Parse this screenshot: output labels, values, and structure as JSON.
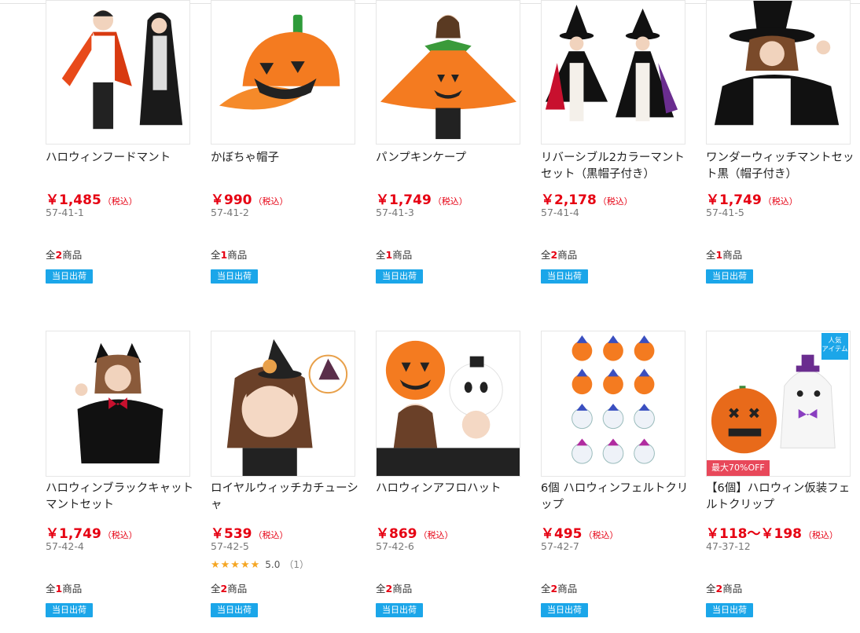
{
  "tax_label": "（税込）",
  "shipping_badge": "当日出荷",
  "count_prefix": "全",
  "count_suffix": "商品",
  "products": [
    {
      "name": "ハロウィンフードマント",
      "price": "￥1,485",
      "code": "57-41-1",
      "count": "2"
    },
    {
      "name": "かぼちゃ帽子",
      "price": "￥990",
      "code": "57-41-2",
      "count": "1"
    },
    {
      "name": "パンプキンケープ",
      "price": "￥1,749",
      "code": "57-41-3",
      "count": "1"
    },
    {
      "name": "リバーシブル2カラーマントセット（黒帽子付き）",
      "price": "￥2,178",
      "code": "57-41-4",
      "count": "2"
    },
    {
      "name": "ワンダーウィッチマントセット黒（帽子付き）",
      "price": "￥1,749",
      "code": "57-41-5",
      "count": "1"
    },
    {
      "name": "ハロウィンブラックキャットマントセット",
      "price": "￥1,749",
      "code": "57-42-4",
      "count": "1"
    },
    {
      "name": "ロイヤルウィッチカチューシャ",
      "price": "￥539",
      "code": "57-42-5",
      "count": "2",
      "rating": {
        "stars": "★★★★★",
        "score": "5.0",
        "count": "（1）",
        "value": 5.0
      }
    },
    {
      "name": "ハロウィンアフロハット",
      "price": "￥869",
      "code": "57-42-6",
      "count": "2"
    },
    {
      "name": "6個 ハロウィンフェルトクリップ",
      "price": "￥495",
      "code": "57-42-7",
      "count": "2"
    },
    {
      "name": "【6個】ハロウィン仮装フェルトクリップ",
      "price": "￥118～￥198",
      "code": "47-37-12",
      "count": "2",
      "corner_tag": "人気\nアイテム",
      "sale_tag": "最大70%OFF"
    }
  ],
  "colors": {
    "price": "#e60012",
    "badge": "#1ba6e9",
    "sale": "#e8485a",
    "stars": "#f5a623"
  }
}
